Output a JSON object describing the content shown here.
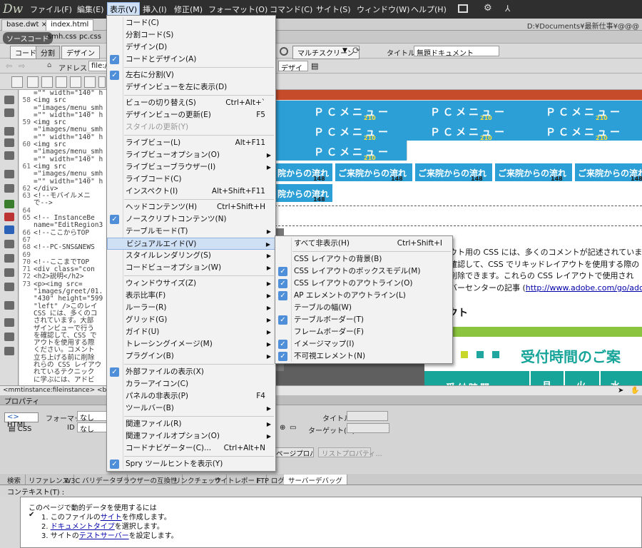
{
  "app": {
    "logo": "Dw",
    "menus": [
      "ファイル(F)",
      "編集(E)",
      "表示(V)",
      "挿入(I)",
      "修正(M)",
      "フォーマット(O)",
      "コマンド(C)",
      "サイト(S)",
      "ウィンドウ(W)",
      "ヘルプ(H)"
    ]
  },
  "docs": {
    "tabs": [
      "base.dwt",
      "index.html"
    ],
    "path": "D:¥Documents¥最新仕事¥@@@"
  },
  "related": [
    "ソースコード",
    "smh.css",
    "pc.css"
  ],
  "toolbar": {
    "views": [
      "コード",
      "分割",
      "デザイン"
    ],
    "address_label": "アドレス :",
    "address": "file://",
    "multiscreen": "マルチスクリーン",
    "title_label": "タイトル :",
    "title": "無題ドキュメント",
    "design_select": "デザイ"
  },
  "code_lines": [
    {
      "n": "",
      "t": "=\"\" width=\"140\" h"
    },
    {
      "n": "58",
      "t": "<img src"
    },
    {
      "n": "",
      "t": "=\"images/menu_smh"
    },
    {
      "n": "",
      "t": "=\"\" width=\"140\" h"
    },
    {
      "n": "59",
      "t": "<img src"
    },
    {
      "n": "",
      "t": "=\"images/menu_smh"
    },
    {
      "n": "",
      "t": "=\"\" width=\"140\" h"
    },
    {
      "n": "60",
      "t": "<img src"
    },
    {
      "n": "",
      "t": "=\"images/menu_smh"
    },
    {
      "n": "",
      "t": "=\"\" width=\"140\" h"
    },
    {
      "n": "61",
      "t": "<img src"
    },
    {
      "n": "",
      "t": "=\"images/menu_smh"
    },
    {
      "n": "",
      "t": "=\"\" width=\"140\" h"
    },
    {
      "n": "62",
      "t": "</div>"
    },
    {
      "n": "63",
      "t": "<!--モバイルメニ"
    },
    {
      "n": "",
      "t": "で-->"
    },
    {
      "n": "64",
      "t": ""
    },
    {
      "n": "65",
      "t": "<!-- InstanceBe"
    },
    {
      "n": "",
      "t": "name=\"EditRegion3"
    },
    {
      "n": "66",
      "t": "<!--ここからTOP"
    },
    {
      "n": "67",
      "t": ""
    },
    {
      "n": "68",
      "t": "<!--PC-SNS&NEWS"
    },
    {
      "n": "69",
      "t": ""
    },
    {
      "n": "70",
      "t": "<!--ここまでTOP"
    },
    {
      "n": "71",
      "t": "<div class=\"con"
    },
    {
      "n": "72",
      "t": "<h2>説明</h2>"
    },
    {
      "n": "73",
      "t": "<p><img src="
    },
    {
      "n": "",
      "t": "\"images/greet/01."
    },
    {
      "n": "",
      "t": "\"430\" height=\"599"
    },
    {
      "n": "",
      "t": "\"left\" />このレイ"
    },
    {
      "n": "",
      "t": "CSS には、多くのコ"
    },
    {
      "n": "",
      "t": "されています。大部"
    },
    {
      "n": "",
      "t": "ザインビューで行う"
    },
    {
      "n": "",
      "t": "を確認して、CSS で"
    },
    {
      "n": "",
      "t": "アウトを使用する際"
    },
    {
      "n": "",
      "t": "ください。コメント"
    },
    {
      "n": "",
      "t": "立ち上げる前に削除"
    },
    {
      "n": "",
      "t": "れらの CSS レイアウ"
    },
    {
      "n": "",
      "t": "れているテクニック"
    },
    {
      "n": "",
      "t": "に学ぶには、アドビ"
    }
  ],
  "design": {
    "pc_label": "ＰＣメニュー",
    "pc_num": "210",
    "greeting": "ご来院からの流れ",
    "greeting_short": "院からの流れ",
    "greeting_num": "148",
    "css_lines": [
      "ウト用の CSS には、多くのコメントが記述されていま",
      "確認して、CSS でリキッドレイアウトを使用する際の",
      "削除できます。これらの CSS レイアウトで使用され",
      "バーセンターの記事 ("
    ],
    "css_link": "http://www.adobe.com/go/ado",
    "reception": "受付時間のご案",
    "reception_cell": "受付時間",
    "week": [
      "月",
      "火",
      "水"
    ],
    "kt": "クト"
  },
  "status": "<mmtinstance:fileinstance> <body> <d",
  "properties": {
    "title": "プロパティ",
    "html": "HTML",
    "css": "CSS",
    "format_label": "フォーマット",
    "format_value": "なし",
    "id_label": "ID",
    "id_value": "なし",
    "title_label": "タイトル",
    "target_label": "ターゲット(G)",
    "page_props": "ページプロパティ...",
    "list_props": "リストプロパティ..."
  },
  "bottom_tabs": [
    "検索",
    "リファレンス",
    "W3C バリデーター",
    "ブラウザーの互換性",
    "リンクチェック",
    "サイトレポート",
    "FTP ログ",
    "サーバーデバッグ"
  ],
  "context_label": "コンテキスト(T) :",
  "debug": {
    "intro": "このページで動的データを使用するには",
    "steps": [
      {
        "pre": "1. このファイルの",
        "link": "サイト",
        "post": "を作成します。"
      },
      {
        "pre": "2. ",
        "link": "ドキュメントタイプ",
        "post": "を選択します。"
      },
      {
        "pre": "3. サイトの",
        "link": "テストサーバー",
        "post": "を設定します。"
      }
    ]
  },
  "view_menu": [
    {
      "label": "コード(C)"
    },
    {
      "label": "分割コード(S)"
    },
    {
      "label": "デザイン(D)"
    },
    {
      "label": "コードとデザイン(A)",
      "checked": true
    },
    {
      "sep": true
    },
    {
      "label": "左右に分割(V)",
      "checked": true
    },
    {
      "label": "デザインビューを左に表示(D)"
    },
    {
      "sep": true
    },
    {
      "label": "ビューの切り替え(S)",
      "shortcut": "Ctrl+Alt+`"
    },
    {
      "label": "デザインビューの更新(E)",
      "shortcut": "F5"
    },
    {
      "label": "スタイルの更新(Y)",
      "disabled": true
    },
    {
      "sep": true
    },
    {
      "label": "ライブビュー(L)",
      "shortcut": "Alt+F11"
    },
    {
      "label": "ライブビューオプション(O)",
      "sub": true
    },
    {
      "label": "ライブビューブラウザー(I)",
      "sub": true
    },
    {
      "label": "ライブコード(C)"
    },
    {
      "label": "インスペクト(I)",
      "shortcut": "Alt+Shift+F11"
    },
    {
      "sep": true
    },
    {
      "label": "ヘッドコンテンツ(H)",
      "shortcut": "Ctrl+Shift+H"
    },
    {
      "label": "ノースクリプトコンテンツ(N)",
      "checked": true
    },
    {
      "label": "テーブルモード(T)",
      "sub": true
    },
    {
      "label": "ビジュアルエイド(V)",
      "sub": true,
      "highlight": true
    },
    {
      "label": "スタイルレンダリング(S)",
      "sub": true
    },
    {
      "label": "コードビューオプション(W)",
      "sub": true
    },
    {
      "sep": true
    },
    {
      "label": "ウィンドウサイズ(Z)",
      "sub": true
    },
    {
      "label": "表示比率(F)",
      "sub": true
    },
    {
      "label": "ルーラー(R)",
      "sub": true
    },
    {
      "label": "グリッド(G)",
      "sub": true
    },
    {
      "label": "ガイド(U)",
      "sub": true
    },
    {
      "label": "トレーシングイメージ(M)",
      "sub": true
    },
    {
      "label": "プラグイン(B)",
      "sub": true
    },
    {
      "sep": true
    },
    {
      "label": "外部ファイルの表示(X)",
      "checked": true
    },
    {
      "label": "カラーアイコン(C)"
    },
    {
      "label": "パネルの非表示(P)",
      "shortcut": "F4"
    },
    {
      "label": "ツールバー(B)",
      "sub": true
    },
    {
      "sep": true
    },
    {
      "label": "関連ファイル(R)",
      "sub": true
    },
    {
      "label": "関連ファイルオプション(O)",
      "sub": true
    },
    {
      "label": "コードナビゲーター(C)...",
      "shortcut": "Ctrl+Alt+N"
    },
    {
      "sep": true
    },
    {
      "label": "Spry ツールヒントを表示(Y)",
      "checked": true
    }
  ],
  "visual_aid_menu": [
    {
      "label": "すべて非表示(H)",
      "shortcut": "Ctrl+Shift+I"
    },
    {
      "sep": true
    },
    {
      "label": "CSS レイアウトの背景(B)"
    },
    {
      "label": "CSS レイアウトのボックスモデル(M)",
      "checked": true
    },
    {
      "label": "CSS レイアウトのアウトライン(O)",
      "checked": true
    },
    {
      "label": "AP エレメントのアウトライン(L)",
      "checked": true
    },
    {
      "label": "テーブルの幅(W)"
    },
    {
      "label": "テーブルボーダー(T)",
      "checked": true
    },
    {
      "label": "フレームボーダー(F)"
    },
    {
      "label": "イメージマップ(I)",
      "checked": true
    },
    {
      "label": "不可視エレメント(N)",
      "checked": true
    }
  ]
}
